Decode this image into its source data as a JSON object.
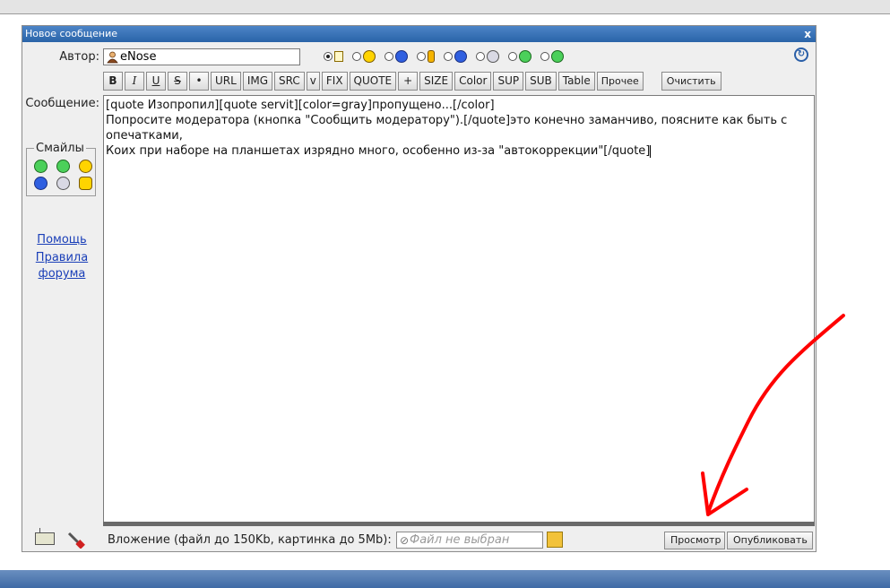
{
  "dialog": {
    "title": "Новое сообщение",
    "close_label": "x"
  },
  "author": {
    "label": "Автор:",
    "value": "eNose"
  },
  "smileys_row": [
    "note",
    "yellow",
    "help",
    "candle",
    "blue",
    "gray",
    "green-glasses",
    "green-grin"
  ],
  "toolbar": {
    "buttons": [
      "B",
      "I",
      "U",
      "S",
      "•",
      "URL",
      "IMG",
      "SRC",
      "v",
      "FIX",
      "QUOTE",
      "+",
      "SIZE",
      "Color",
      "SUP",
      "SUB",
      "Table",
      "Прочее"
    ],
    "clear_label": "Очистить"
  },
  "message": {
    "label": "Сообщение:",
    "lines": [
      "[quote Изопропил][quote servit][color=gray]пропущено...[/color]",
      "Попросите модератора (кнопка \"Сообщить модератору\").[/quote]это конечно заманчиво, поясните как быть с",
      "опечатками,",
      "Коих при наборе на планшетах изрядно много, особенно из-за \"автокоррекции\"[/quote]"
    ]
  },
  "smiles_panel": {
    "legend": "Смайлы",
    "icons": [
      "green-grin",
      "green-glasses",
      "yellow-sunglasses",
      "blue",
      "gray",
      "cat"
    ]
  },
  "help": {
    "help_link": "Помощь",
    "rules_link_line1": "Правила",
    "rules_link_line2": "форума"
  },
  "attachment": {
    "label": "Вложение (файл до 150Kb, картинка до 5Mb):",
    "placeholder": "Файл не выбран"
  },
  "actions": {
    "preview": "Просмотр",
    "publish": "Опубликовать"
  },
  "colors": {
    "title_bar": "#2a64a8",
    "annotation": "#ff0000",
    "link": "#1a3fb8"
  }
}
